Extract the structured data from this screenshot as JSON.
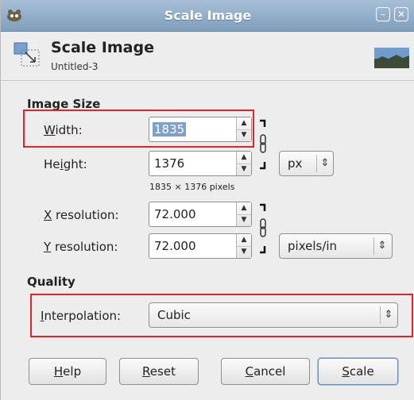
{
  "window": {
    "title": "Scale Image",
    "controls": [
      "minimize-icon",
      "close-icon"
    ]
  },
  "header": {
    "title": "Scale Image",
    "subtitle": "Untitled-3"
  },
  "image_size": {
    "section_label": "Image Size",
    "width": {
      "mnemonic": "W",
      "rest": "idth:",
      "value": "1835"
    },
    "height": {
      "pre": "He",
      "mnemonic": "i",
      "rest": "ght:",
      "value": "1376"
    },
    "pixels_note": "1835 × 1376 pixels",
    "unit": "px",
    "x_resolution": {
      "mnemonic": "X",
      "rest": " resolution:",
      "value": "72.000"
    },
    "y_resolution": {
      "mnemonic": "Y",
      "rest": " resolution:",
      "value": "72.000"
    },
    "resolution_unit": "pixels/in"
  },
  "quality": {
    "section_label": "Quality",
    "interpolation": {
      "mnemonic": "I",
      "rest": "nterpolation:",
      "value": "Cubic"
    }
  },
  "buttons": {
    "help": {
      "mnemonic": "H",
      "rest": "elp"
    },
    "reset": {
      "mnemonic": "R",
      "rest": "eset"
    },
    "cancel": {
      "mnemonic": "C",
      "rest": "ancel"
    },
    "scale": {
      "mnemonic": "S",
      "rest": "cale"
    }
  },
  "colors": {
    "highlight_box": "#e0242a",
    "titlebar": "#8fadca",
    "selection": "#7fa1c9"
  }
}
